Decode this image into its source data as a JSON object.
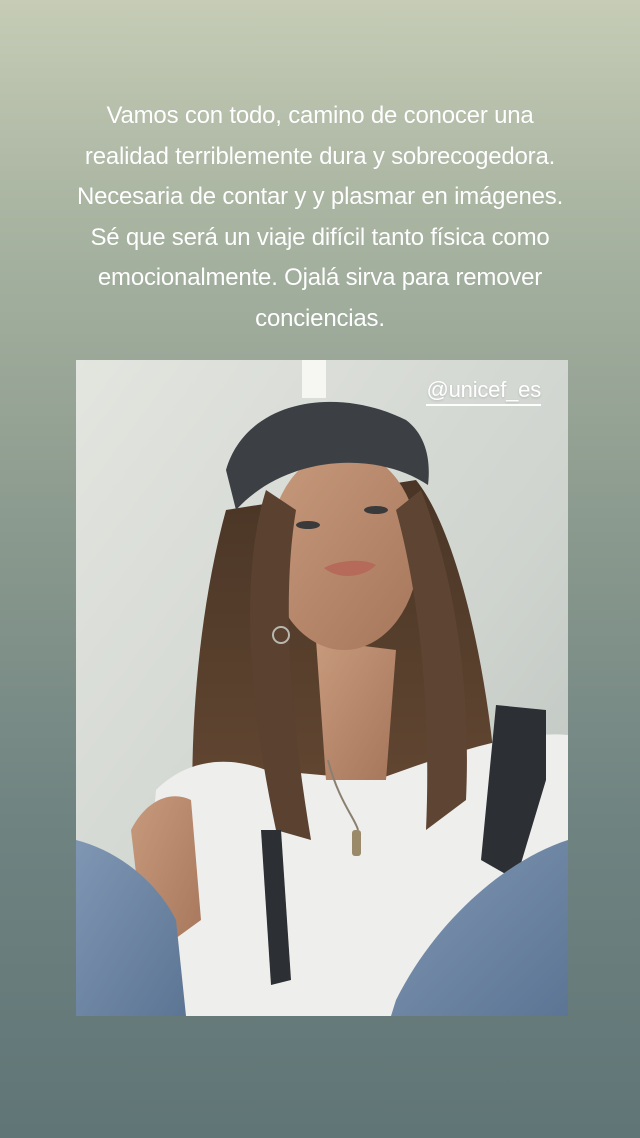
{
  "story": {
    "caption": "Vamos con todo, camino de conocer una realidad terriblemente dura y sobrecogedora. Necesaria de contar y y plasmar en imágenes. Sé que será un viaje difícil tanto física como emocionalmente. Ojalá sirva para remover conciencias.",
    "mention_tag": "@unicef_es"
  },
  "colors": {
    "background_top": "#c6ccb6",
    "background_bottom": "#607576",
    "text": "#ffffff"
  }
}
